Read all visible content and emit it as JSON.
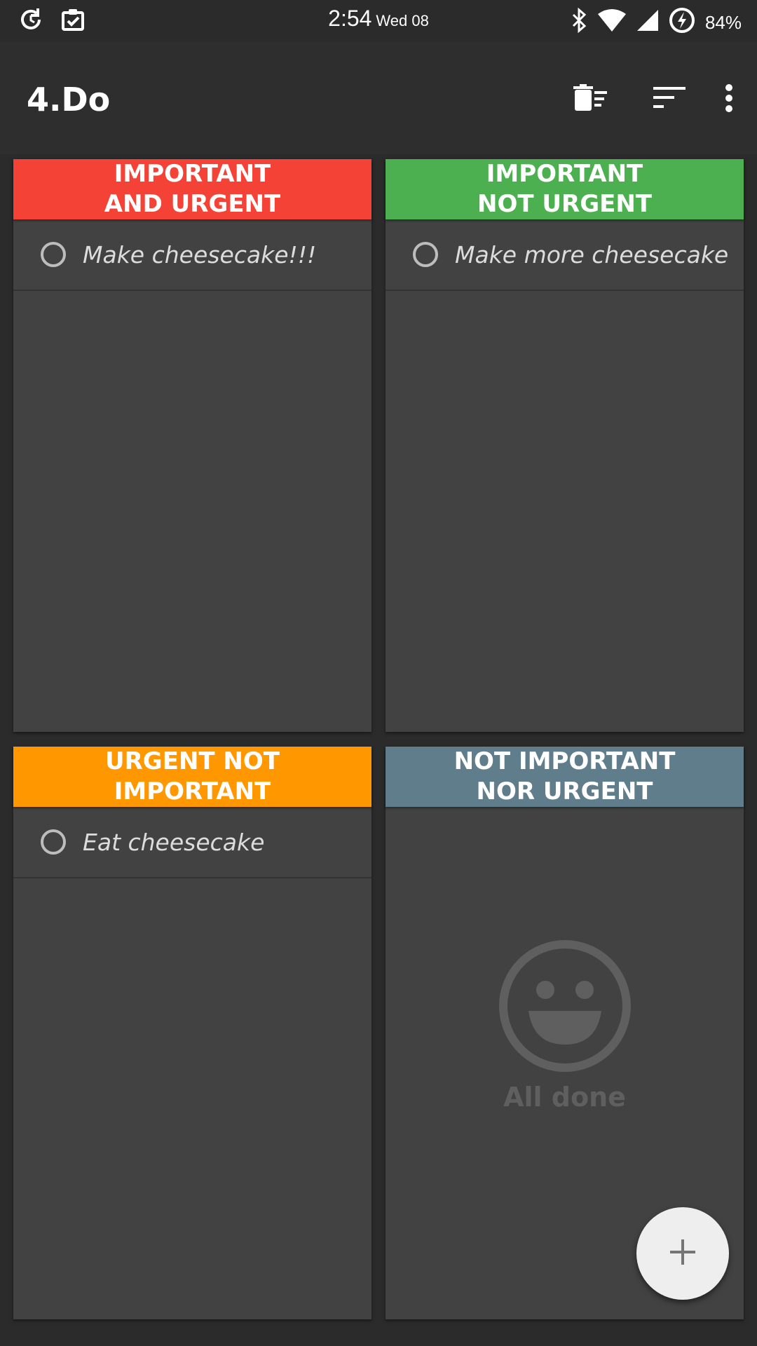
{
  "status_bar": {
    "time": "2:54",
    "date": "Wed 08",
    "battery": "84%",
    "icons_left": [
      "sync-icon",
      "clipboard-check-icon"
    ],
    "icons_right": [
      "bluetooth-icon",
      "wifi-icon",
      "cell-signal-icon",
      "battery-charging-icon"
    ]
  },
  "app_bar": {
    "title": "4.Do",
    "actions": [
      "delete-done-icon",
      "sort-icon",
      "more-vert-icon"
    ]
  },
  "quadrants": [
    {
      "title": "IMPORTANT\nAND URGENT",
      "color": "#f44336",
      "tasks": [
        {
          "text": "Make cheesecake!!!"
        }
      ]
    },
    {
      "title": "IMPORTANT\nNOT URGENT",
      "color": "#4caf50",
      "tasks": [
        {
          "text": "Make more cheesecake"
        }
      ]
    },
    {
      "title": "URGENT NOT\nIMPORTANT",
      "color": "#ff9800",
      "tasks": [
        {
          "text": "Eat cheesecake"
        }
      ]
    },
    {
      "title": "NOT IMPORTANT\nNOR URGENT",
      "color": "#607d8b",
      "tasks": [],
      "empty_label": "All done"
    }
  ],
  "fab": {
    "icon": "add-icon"
  }
}
